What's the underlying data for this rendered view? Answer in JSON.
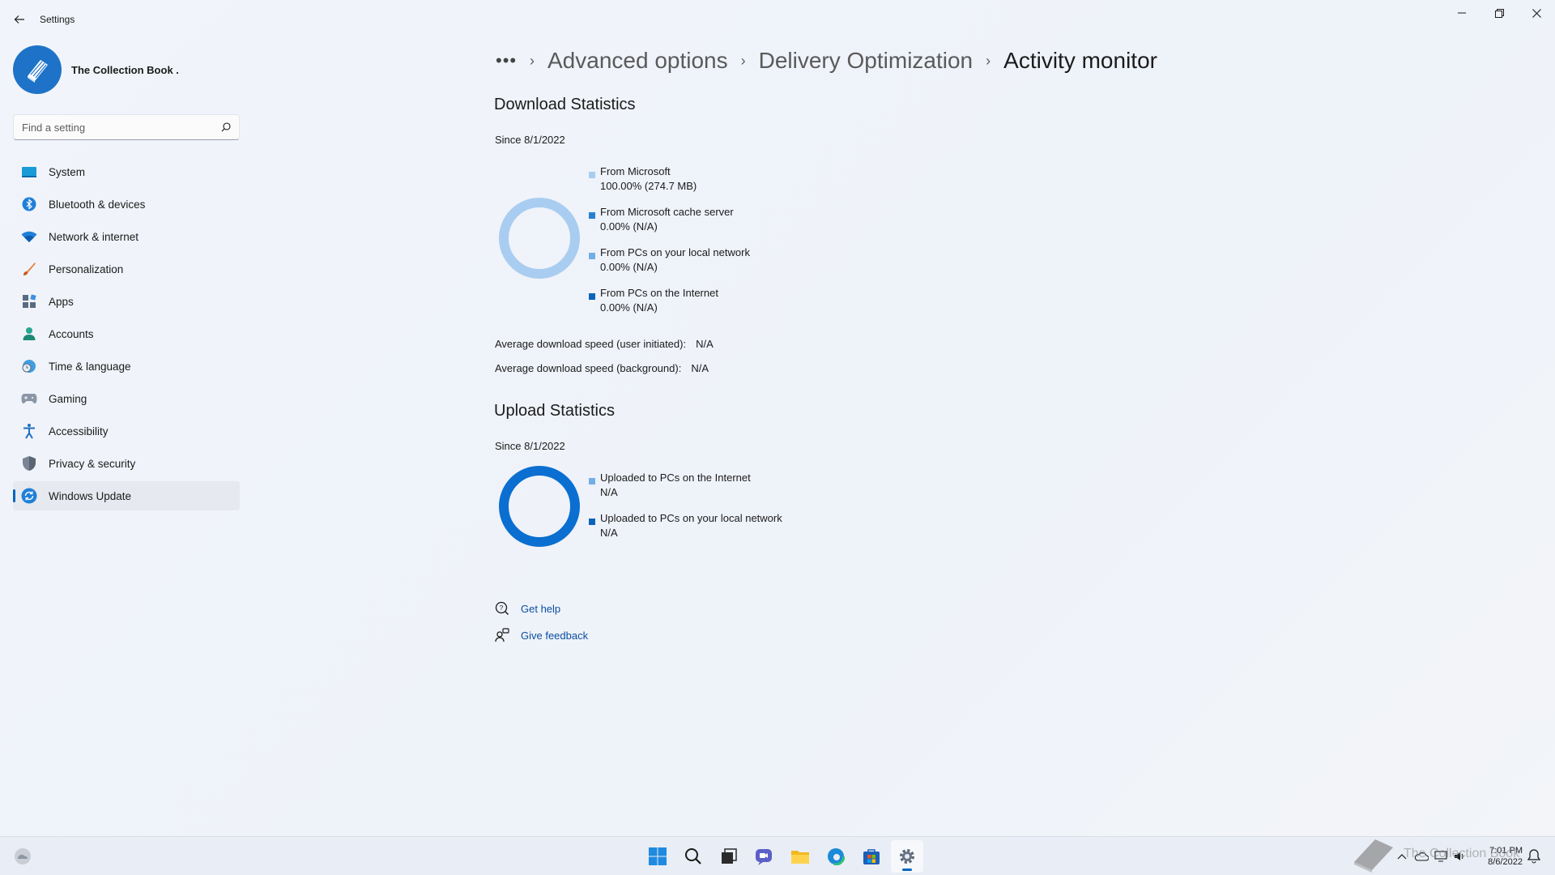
{
  "app": {
    "title": "Settings"
  },
  "profile": {
    "name": "The Collection Book ."
  },
  "search": {
    "placeholder": "Find a setting"
  },
  "sidebar": {
    "items": [
      {
        "label": "System",
        "icon": "system-icon"
      },
      {
        "label": "Bluetooth & devices",
        "icon": "bluetooth-icon"
      },
      {
        "label": "Network & internet",
        "icon": "wifi-icon"
      },
      {
        "label": "Personalization",
        "icon": "brush-icon"
      },
      {
        "label": "Apps",
        "icon": "apps-icon"
      },
      {
        "label": "Accounts",
        "icon": "account-icon"
      },
      {
        "label": "Time & language",
        "icon": "clock-globe-icon"
      },
      {
        "label": "Gaming",
        "icon": "gamepad-icon"
      },
      {
        "label": "Accessibility",
        "icon": "accessibility-icon"
      },
      {
        "label": "Privacy & security",
        "icon": "shield-icon"
      },
      {
        "label": "Windows Update",
        "icon": "windows-update-icon",
        "active": true
      }
    ]
  },
  "breadcrumb": {
    "more": "•••",
    "items": [
      "Advanced options",
      "Delivery Optimization"
    ],
    "current": "Activity monitor"
  },
  "download": {
    "title": "Download Statistics",
    "since": "Since 8/1/2022",
    "legend": [
      {
        "label": "From Microsoft",
        "value": "100.00%  (274.7 MB)",
        "color": "#a9cdf0"
      },
      {
        "label": "From Microsoft cache server",
        "value": "0.00%  (N/A)",
        "color": "#2b7fd0"
      },
      {
        "label": "From PCs on your local network",
        "value": "0.00%  (N/A)",
        "color": "#72afe6"
      },
      {
        "label": "From PCs on the Internet",
        "value": "0.00%  (N/A)",
        "color": "#0a64b8"
      }
    ],
    "avg_user_label": "Average download speed (user initiated):",
    "avg_user_value": "N/A",
    "avg_bg_label": "Average download speed (background):",
    "avg_bg_value": "N/A"
  },
  "upload": {
    "title": "Upload Statistics",
    "since": "Since 8/1/2022",
    "legend": [
      {
        "label": "Uploaded to PCs on the Internet",
        "value": "N/A",
        "color": "#72afe6"
      },
      {
        "label": "Uploaded to PCs on your local network",
        "value": "N/A",
        "color": "#0a64b8"
      }
    ]
  },
  "chart_data": [
    {
      "type": "pie",
      "title": "Download Statistics",
      "categories": [
        "From Microsoft",
        "From Microsoft cache server",
        "From PCs on your local network",
        "From PCs on the Internet"
      ],
      "values": [
        100.0,
        0.0,
        0.0,
        0.0
      ]
    },
    {
      "type": "pie",
      "title": "Upload Statistics",
      "categories": [
        "Uploaded to PCs on the Internet",
        "Uploaded to PCs on your local network"
      ],
      "values": [
        null,
        null
      ]
    }
  ],
  "help": {
    "get_help": "Get help",
    "give_feedback": "Give feedback"
  },
  "taskbar": {
    "apps": [
      "start-icon",
      "search-icon",
      "task-view-icon",
      "chat-icon",
      "file-explorer-icon",
      "edge-icon",
      "store-icon",
      "settings-icon"
    ],
    "time": "7:01 PM",
    "date": "8/6/2022"
  },
  "watermark": {
    "text": "The Collection Book"
  }
}
